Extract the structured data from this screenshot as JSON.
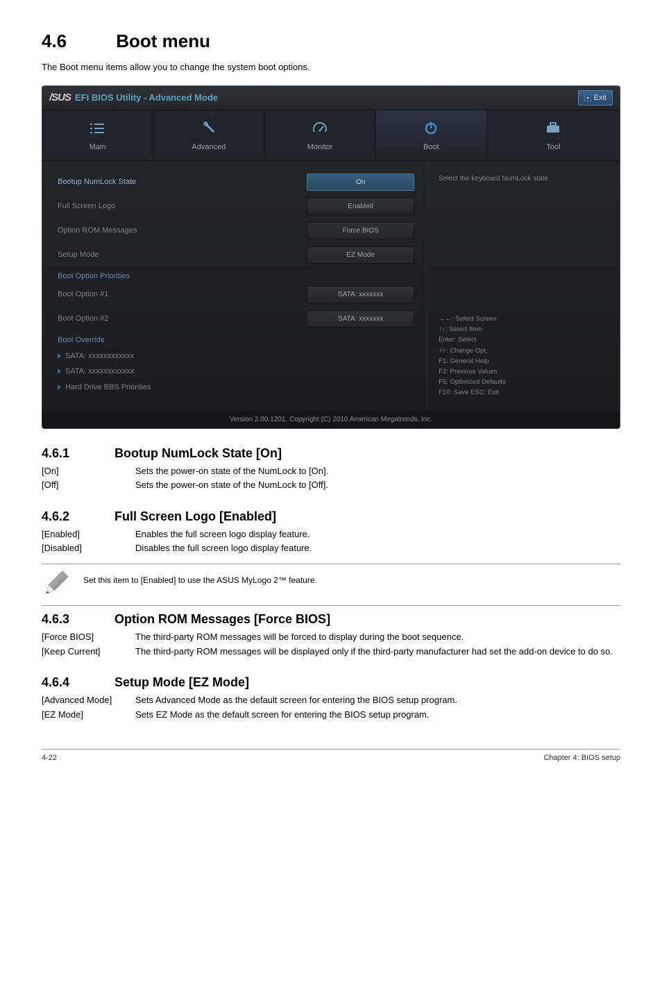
{
  "page": {
    "section_number": "4.6",
    "section_title": "Boot menu",
    "intro": "The Boot menu items allow you to change the system boot options."
  },
  "bios": {
    "titlebar": {
      "logo": "/SUS",
      "title": "EFI BIOS Utility - Advanced Mode",
      "exit": "Exit"
    },
    "tabs": {
      "main": "Main",
      "advanced": "Advanced",
      "monitor": "Monitor",
      "boot": "Boot",
      "tool": "Tool"
    },
    "settings": {
      "numlock_label": "Bootup NumLock State",
      "numlock_value": "On",
      "logo_label": "Full Screen Logo",
      "logo_value": "Enabled",
      "rom_label": "Option ROM Messages",
      "rom_value": "Force BIOS",
      "setup_label": "Setup Mode",
      "setup_value": "EZ Mode"
    },
    "priorities": {
      "header": "Boot Option Priorities",
      "opt1_label": "Boot Option #1",
      "opt1_value": "SATA: xxxxxxx",
      "opt2_label": "Boot Option #2",
      "opt2_value": "SATA: xxxxxxx"
    },
    "override": {
      "header": "Boot Override",
      "item1": "SATA: xxxxxxxxxxxx",
      "item2": "SATA: xxxxxxxxxxxx",
      "item3": "Hard Drive BBS Priorities"
    },
    "help_title": "Select the keyboard NumLock state",
    "keys": {
      "k1": "→←: Select Screen",
      "k2": "↑↓: Select Item",
      "k3": "Enter: Select",
      "k4": "+/-: Change Opt.",
      "k5": "F1: General Help",
      "k6": "F2: Previous Values",
      "k7": "F5: Optimized Defaults",
      "k8": "F10: Save   ESC: Exit"
    },
    "footer": "Version 2.00.1201.   Copyright (C) 2010 American Megatrends, Inc."
  },
  "s461": {
    "num": "4.6.1",
    "title": "Bootup NumLock State [On]",
    "rows": [
      {
        "k": "[On]",
        "v": "Sets the power-on state of the NumLock to [On]."
      },
      {
        "k": "[Off]",
        "v": "Sets the power-on state of the NumLock to [Off]."
      }
    ]
  },
  "s462": {
    "num": "4.6.2",
    "title": "Full Screen Logo [Enabled]",
    "rows": [
      {
        "k": "[Enabled]",
        "v": "Enables the full screen logo display feature."
      },
      {
        "k": "[Disabled]",
        "v": "Disables the full screen logo display feature."
      }
    ],
    "note": "Set this item to [Enabled] to use the ASUS MyLogo 2™ feature."
  },
  "s463": {
    "num": "4.6.3",
    "title": "Option ROM Messages [Force BIOS]",
    "rows": [
      {
        "k": "[Force BIOS]",
        "v": "The third-party ROM messages will be forced to display during the boot sequence."
      },
      {
        "k": "[Keep Current]",
        "v": "The third-party ROM messages will be displayed only if the third-party manufacturer had set the add-on device to do so."
      }
    ]
  },
  "s464": {
    "num": "4.6.4",
    "title": "Setup Mode [EZ Mode]",
    "rows": [
      {
        "k": "[Advanced Mode]",
        "v": "Sets Advanced Mode as the default screen for entering the BIOS setup program."
      },
      {
        "k": "[EZ Mode]",
        "v": "Sets EZ Mode as the default screen for entering the BIOS setup program."
      }
    ]
  },
  "footer": {
    "left": "4-22",
    "right": "Chapter 4: BIOS setup"
  }
}
